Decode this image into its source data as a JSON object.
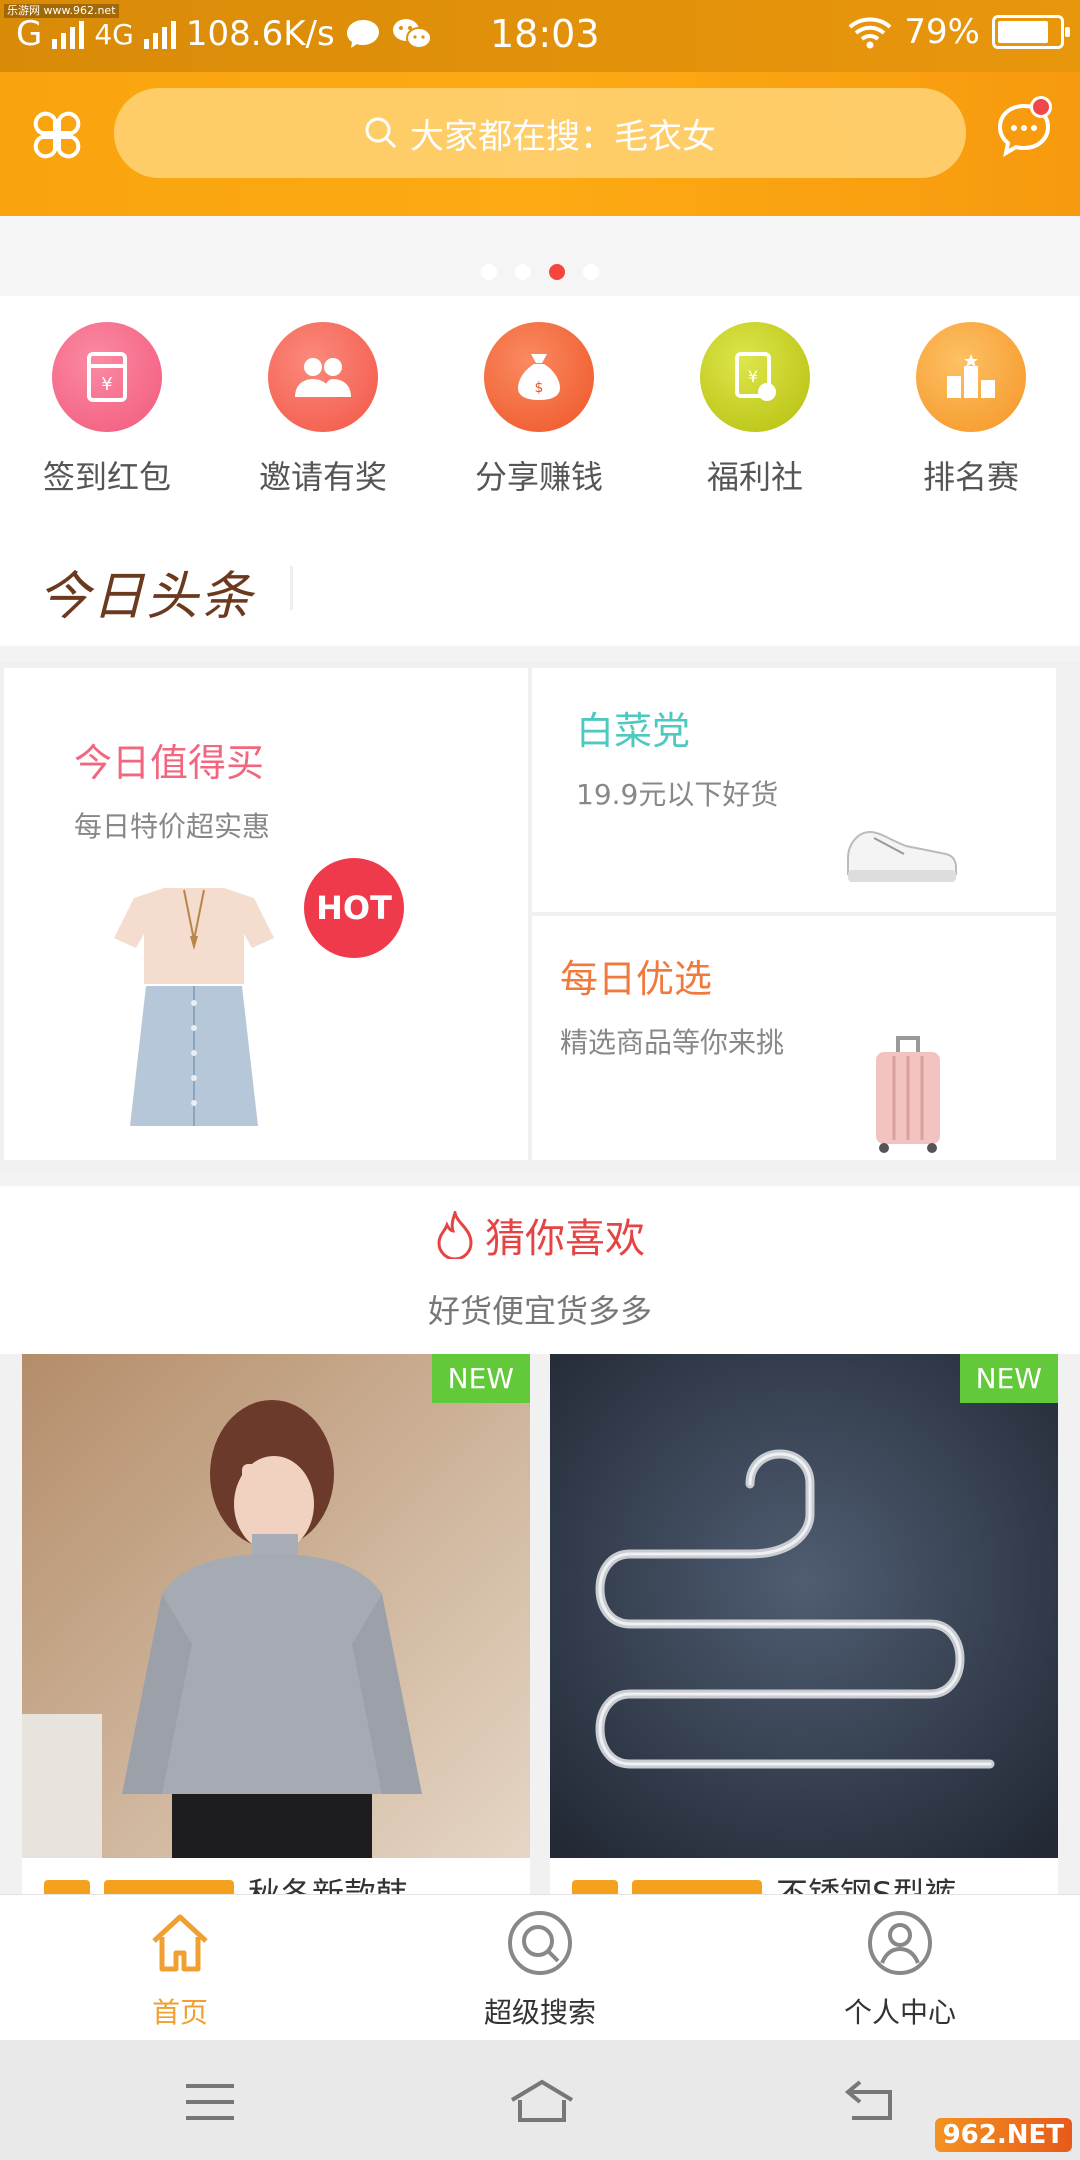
{
  "status_bar": {
    "carrier_left": "G",
    "network": "4G",
    "speed": "108.6K/s",
    "time": "18:03",
    "battery": "79%",
    "tiny_url": "乐游网 www.962.net"
  },
  "header": {
    "search_placeholder": "大家都在搜：毛衣女"
  },
  "banner": {
    "active_dot": 3,
    "dot_count": 4
  },
  "quick_menu": [
    {
      "label": "签到红包",
      "icon": "red-envelope-icon",
      "color": "#f56f8c"
    },
    {
      "label": "邀请有奖",
      "icon": "users-icon",
      "color": "#f7685a"
    },
    {
      "label": "分享赚钱",
      "icon": "money-bag-icon",
      "color": "#f56e3f"
    },
    {
      "label": "福利社",
      "icon": "coupon-icon",
      "color": "#c7cf16"
    },
    {
      "label": "排名赛",
      "icon": "ranking-icon",
      "color": "#f8a23a"
    }
  ],
  "headline_label": "今日头条",
  "promo": {
    "left": {
      "title": "今日值得买",
      "subtitle": "每日特价超实惠",
      "badge": "HOT",
      "title_color": "#f0677f"
    },
    "right_top": {
      "title": "白菜党",
      "subtitle": "19.9元以下好货",
      "title_color": "#4ec9c0"
    },
    "right_bottom": {
      "title": "每日优选",
      "subtitle": "精选商品等你来挑",
      "title_color": "#f07a3e"
    }
  },
  "guess": {
    "title": "猜你喜欢",
    "subtitle": "好货便宜货多多"
  },
  "products": [
    {
      "badge": "NEW",
      "title": "秋冬新款韩"
    },
    {
      "badge": "NEW",
      "title": "不锈钢S型裤"
    }
  ],
  "tabbar": [
    {
      "label": "首页",
      "active": true
    },
    {
      "label": "超级搜索",
      "active": false
    },
    {
      "label": "个人中心",
      "active": false
    }
  ],
  "watermark": "962.NET"
}
